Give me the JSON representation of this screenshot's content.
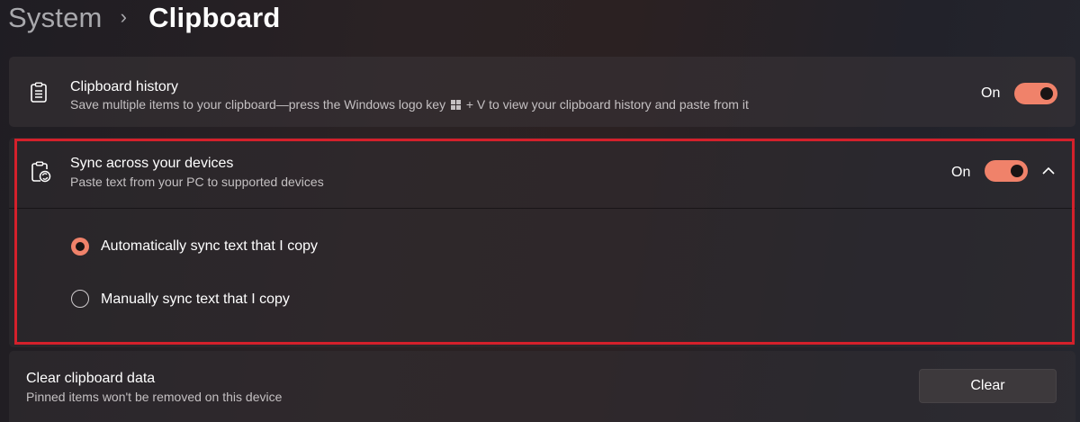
{
  "breadcrumb": {
    "parent": "System",
    "separator": "›",
    "current": "Clipboard"
  },
  "clipboard_history": {
    "title": "Clipboard history",
    "description_before": "Save multiple items to your clipboard—press the Windows logo key",
    "description_after": "+ V to view your clipboard history and paste from it",
    "state_label": "On",
    "enabled": true,
    "icon": "clipboard-list-icon"
  },
  "sync": {
    "title": "Sync across your devices",
    "description": "Paste text from your PC to supported devices",
    "state_label": "On",
    "enabled": true,
    "expanded": true,
    "icon": "clipboard-sync-icon",
    "options": [
      {
        "label": "Automatically sync text that I copy",
        "selected": true
      },
      {
        "label": "Manually sync text that I copy",
        "selected": false
      }
    ]
  },
  "clear_data": {
    "title": "Clear clipboard data",
    "description": "Pinned items won't be removed on this device",
    "button_label": "Clear"
  },
  "colors": {
    "accent": "#f0826a",
    "highlight_border": "#d4202b"
  }
}
